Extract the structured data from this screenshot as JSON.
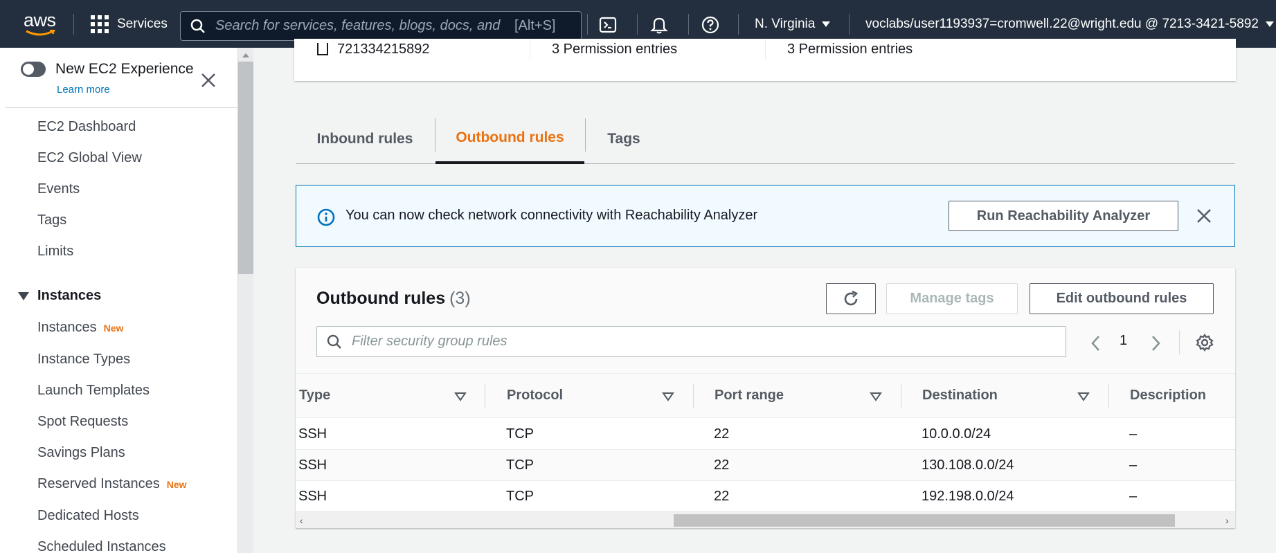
{
  "topnav": {
    "logo_text": "aws",
    "services_label": "Services",
    "search_placeholder": "Search for services, features, blogs, docs, and",
    "search_shortcut": "[Alt+S]",
    "region": "N. Virginia",
    "account": "voclabs/user1193937=cromwell.22@wright.edu @ 7213-3421-5892",
    "icons": [
      "grid-icon",
      "search-icon",
      "cloudshell-icon",
      "bell-icon",
      "help-icon"
    ],
    "colors": {
      "background": "#232f3e",
      "accent": "#ff9900"
    }
  },
  "sidebar": {
    "new_experience_label": "New EC2 Experience",
    "learn_more": "Learn more",
    "top_items": [
      {
        "label": "EC2 Dashboard"
      },
      {
        "label": "EC2 Global View"
      },
      {
        "label": "Events"
      },
      {
        "label": "Tags"
      },
      {
        "label": "Limits"
      }
    ],
    "section_title": "Instances",
    "section_items": [
      {
        "label": "Instances",
        "badge": "New"
      },
      {
        "label": "Instance Types",
        "badge": ""
      },
      {
        "label": "Launch Templates",
        "badge": ""
      },
      {
        "label": "Spot Requests",
        "badge": ""
      },
      {
        "label": "Savings Plans",
        "badge": ""
      },
      {
        "label": "Reserved Instances",
        "badge": "New"
      },
      {
        "label": "Dedicated Hosts",
        "badge": ""
      },
      {
        "label": "Scheduled Instances",
        "badge": ""
      }
    ]
  },
  "details_card": {
    "owner": "721334215892",
    "inbound_count": "3 Permission entries",
    "outbound_count": "3 Permission entries"
  },
  "tabs": [
    {
      "label": "Inbound rules",
      "active": false
    },
    {
      "label": "Outbound rules",
      "active": true
    },
    {
      "label": "Tags",
      "active": false
    }
  ],
  "flash": {
    "message": "You can now check network connectivity with Reachability Analyzer",
    "button": "Run Reachability Analyzer"
  },
  "rules_table": {
    "title": "Outbound rules",
    "count": "(3)",
    "manage_tags": "Manage tags",
    "edit_button": "Edit outbound rules",
    "filter_placeholder": "Filter security group rules",
    "page": "1",
    "columns": [
      "Type",
      "Protocol",
      "Port range",
      "Destination",
      "Description"
    ],
    "rows": [
      [
        "SSH",
        "TCP",
        "22",
        "10.0.0.0/24",
        "–"
      ],
      [
        "SSH",
        "TCP",
        "22",
        "130.108.0.0/24",
        "–"
      ],
      [
        "SSH",
        "TCP",
        "22",
        "192.198.0.0/24",
        "–"
      ]
    ]
  }
}
